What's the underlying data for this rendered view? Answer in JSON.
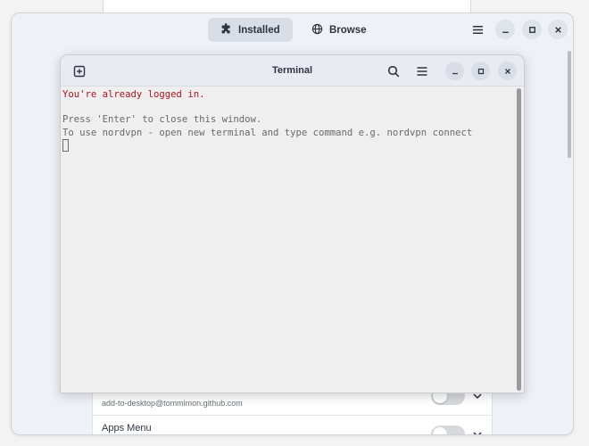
{
  "extension_manager": {
    "tabs": [
      {
        "label": "Installed",
        "icon": "puzzle-icon",
        "active": true
      },
      {
        "label": "Browse",
        "icon": "globe-icon",
        "active": false
      }
    ],
    "extensions": [
      {
        "name": "",
        "subtitle": "add-to-desktop@tommimon.github.com",
        "enabled": false
      },
      {
        "name": "Apps Menu",
        "subtitle": "",
        "enabled": false
      }
    ]
  },
  "terminal": {
    "title": "Terminal",
    "lines": [
      {
        "text": "You're already logged in.",
        "color": "#b3141b"
      },
      {
        "text": "",
        "color": "#6a6a6a"
      },
      {
        "text": "Press 'Enter' to close this window.",
        "color": "#6a6a6a"
      },
      {
        "text": "To use nordvpn - open new terminal and type command e.g. nordvpn connect",
        "color": "#6a6a6a"
      }
    ]
  },
  "colors": {
    "accent_red": "#b3141b",
    "window_bg": "#eef1f6",
    "terminal_bg": "#efefef"
  }
}
